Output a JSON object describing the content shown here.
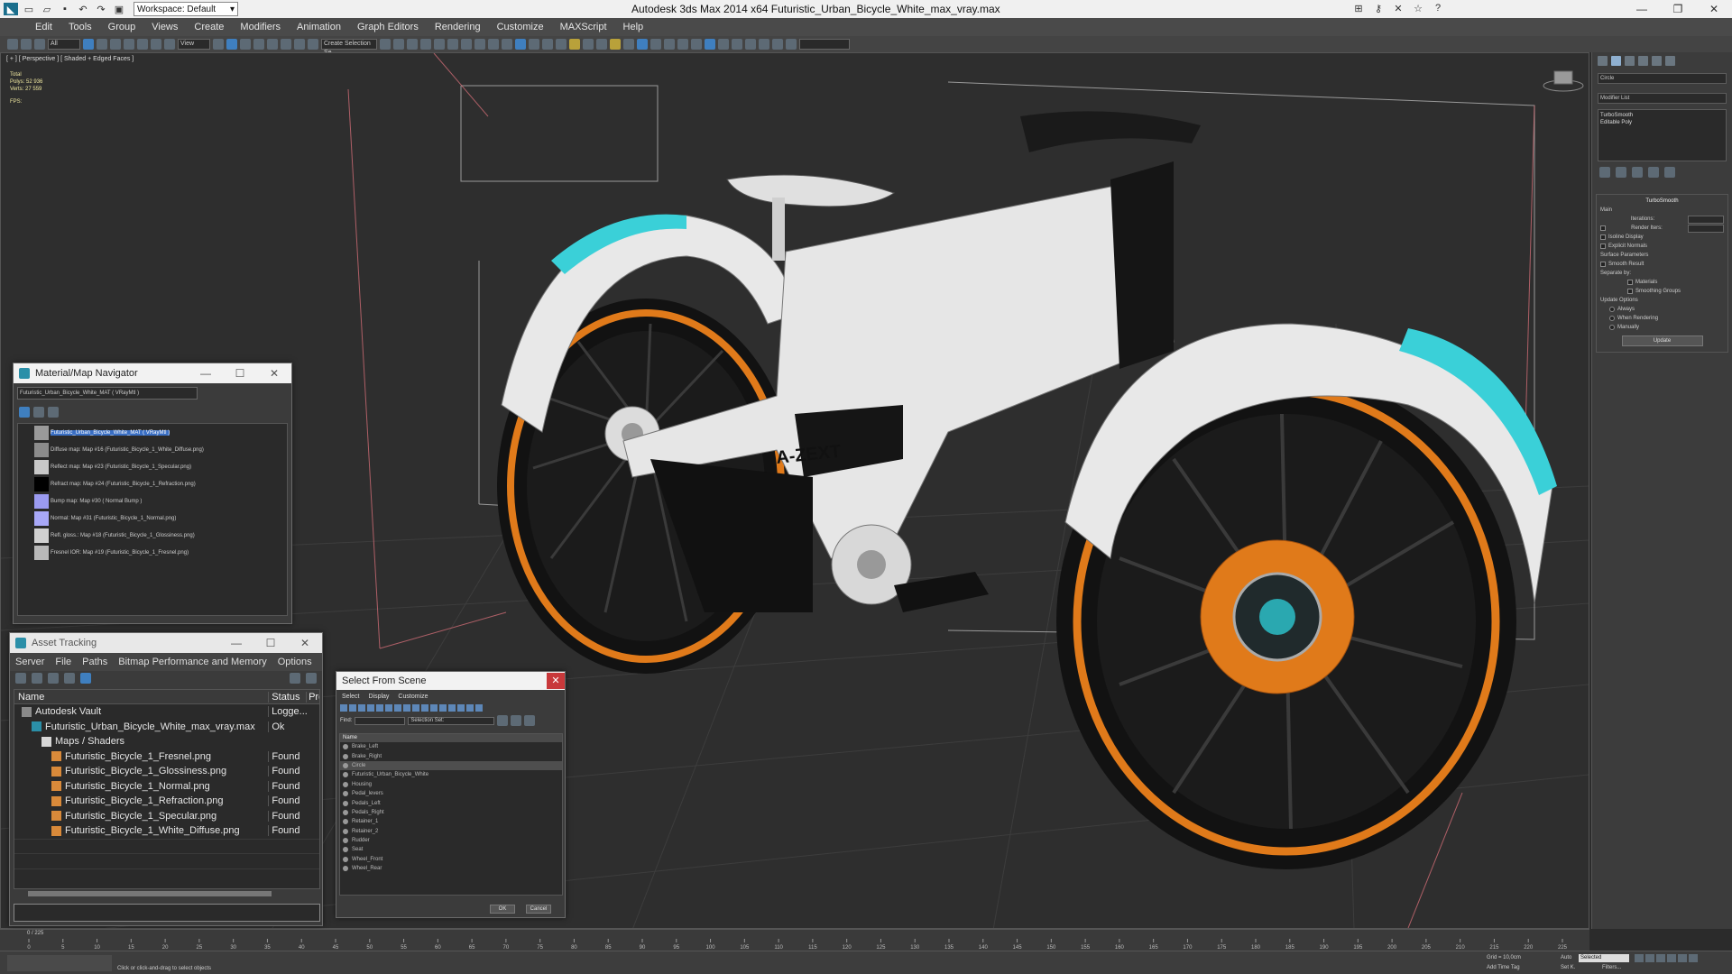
{
  "app": {
    "title": "Autodesk 3ds Max  2014 x64    Futuristic_Urban_Bicycle_White_max_vray.max",
    "workspace": "Workspace: Default"
  },
  "menu": [
    "Edit",
    "Tools",
    "Group",
    "Views",
    "Create",
    "Modifiers",
    "Animation",
    "Graph Editors",
    "Rendering",
    "Customize",
    "MAXScript",
    "Help"
  ],
  "toolbar": {
    "filter_select": "All",
    "view_select": "View",
    "selection_set": "Create Selection Se"
  },
  "viewport": {
    "label": "[ + ] [ Perspective ] [ Shaded + Edged Faces ]",
    "stats": {
      "total_label": "Total",
      "polys_label": "Polys:",
      "polys": "52 936",
      "verts_label": "Verts:",
      "verts": "27 559",
      "fps_label": "FPS:"
    },
    "decal_text": "A-ZEXT"
  },
  "command_panel": {
    "object_name": "Circle",
    "modifier_list": "Modifier List",
    "stack": [
      "TurboSmooth",
      "Editable Poly"
    ],
    "turbosmooth": {
      "title": "TurboSmooth",
      "main": "Main",
      "iterations": "Iterations:",
      "render_iters": "Render Iters:",
      "isoline": "Isoline Display",
      "explicit_normals": "Explicit Normals",
      "surface_params": "Surface Parameters",
      "smooth_result": "Smooth Result",
      "separate_by": "Separate by:",
      "materials": "Materials",
      "smoothing_groups": "Smoothing Groups",
      "update_options": "Update Options",
      "always": "Always",
      "when_rendering": "When Rendering",
      "manually": "Manually",
      "update_button": "Update"
    }
  },
  "material_navigator": {
    "title": "Material/Map Navigator",
    "field": "Futuristic_Urban_Bicycle_White_MAT  ( VRayMtl )",
    "items": [
      {
        "label": "Futuristic_Urban_Bicycle_White_MAT  ( VRayMtl )",
        "selected": true,
        "color": "#9a9a9a"
      },
      {
        "label": "Diffuse map: Map #16 (Futuristic_Bicycle_1_White_Diffuse.png)",
        "selected": false,
        "color": "#8c8c8c"
      },
      {
        "label": "Reflect map: Map #23 (Futuristic_Bicycle_1_Specular.png)",
        "selected": false,
        "color": "#c8c8c8"
      },
      {
        "label": "Refract map: Map #24 (Futuristic_Bicycle_1_Refraction.png)",
        "selected": false,
        "color": "#000000"
      },
      {
        "label": "Bump map: Map #30 ( Normal Bump )",
        "selected": false,
        "color": "#9a9af0"
      },
      {
        "label": "Normal: Map #31 (Futuristic_Bicycle_1_Normal.png)",
        "selected": false,
        "color": "#a8a8f8"
      },
      {
        "label": "Refl. gloss.: Map #18 (Futuristic_Bicycle_1_Glossiness.png)",
        "selected": false,
        "color": "#d0d0d0"
      },
      {
        "label": "Fresnel IOR: Map #19 (Futuristic_Bicycle_1_Fresnel.png)",
        "selected": false,
        "color": "#b8b8b8"
      }
    ]
  },
  "asset_tracking": {
    "title": "Asset Tracking",
    "menu": [
      "Server",
      "File",
      "Paths",
      "Bitmap Performance and Memory",
      "Options"
    ],
    "columns": {
      "name": "Name",
      "status": "Status",
      "pro": "Pro"
    },
    "rows": [
      {
        "name": "Autodesk Vault",
        "status": "Logge...",
        "indent": 0,
        "icon": "vault"
      },
      {
        "name": "Futuristic_Urban_Bicycle_White_max_vray.max",
        "status": "Ok",
        "indent": 1,
        "icon": "max"
      },
      {
        "name": "Maps / Shaders",
        "status": "",
        "indent": 2,
        "icon": "folder"
      },
      {
        "name": "Futuristic_Bicycle_1_Fresnel.png",
        "status": "Found",
        "indent": 3,
        "icon": "image"
      },
      {
        "name": "Futuristic_Bicycle_1_Glossiness.png",
        "status": "Found",
        "indent": 3,
        "icon": "image"
      },
      {
        "name": "Futuristic_Bicycle_1_Normal.png",
        "status": "Found",
        "indent": 3,
        "icon": "image"
      },
      {
        "name": "Futuristic_Bicycle_1_Refraction.png",
        "status": "Found",
        "indent": 3,
        "icon": "image"
      },
      {
        "name": "Futuristic_Bicycle_1_Specular.png",
        "status": "Found",
        "indent": 3,
        "icon": "image"
      },
      {
        "name": "Futuristic_Bicycle_1_White_Diffuse.png",
        "status": "Found",
        "indent": 3,
        "icon": "image"
      }
    ]
  },
  "select_from_scene": {
    "title": "Select From Scene",
    "menu": [
      "Select",
      "Display",
      "Customize"
    ],
    "find_label": "Find:",
    "selection_set": "Selection Set:",
    "column": "Name",
    "items": [
      "Brake_Left",
      "Brake_Right",
      "Circle",
      "Futuristic_Urban_Bicycle_White",
      "Housing",
      "Pedal_levers",
      "Pedals_Left",
      "Pedals_Right",
      "Retainer_1",
      "Retainer_2",
      "Rudder",
      "Seat",
      "Wheel_Front",
      "Wheel_Rear"
    ],
    "selected_index": 2,
    "ok": "OK",
    "cancel": "Cancel"
  },
  "timeline": {
    "counter": "0 / 225",
    "ticks": [
      "0",
      "5",
      "10",
      "15",
      "20",
      "25",
      "30",
      "35",
      "40",
      "45",
      "50",
      "55",
      "60",
      "65",
      "70",
      "75",
      "80",
      "85",
      "90",
      "95",
      "100",
      "105",
      "110",
      "115",
      "120",
      "125",
      "130",
      "135",
      "140",
      "145",
      "150",
      "155",
      "160",
      "165",
      "170",
      "175",
      "180",
      "185",
      "190",
      "195",
      "200",
      "205",
      "210",
      "215",
      "220",
      "225"
    ]
  },
  "status": {
    "prompt": "Click or click-and-drag to select objects",
    "grid": "Grid = 10,0cm",
    "add_time_tag": "Add Time Tag",
    "auto": "Auto",
    "selected": "Selected",
    "set_k": "Set K.",
    "filters": "Filters..."
  },
  "colors": {
    "cyan": "#3ad0d8",
    "orange": "#e07a1a",
    "frame_white": "#e8e8e8",
    "tire": "#141414"
  }
}
